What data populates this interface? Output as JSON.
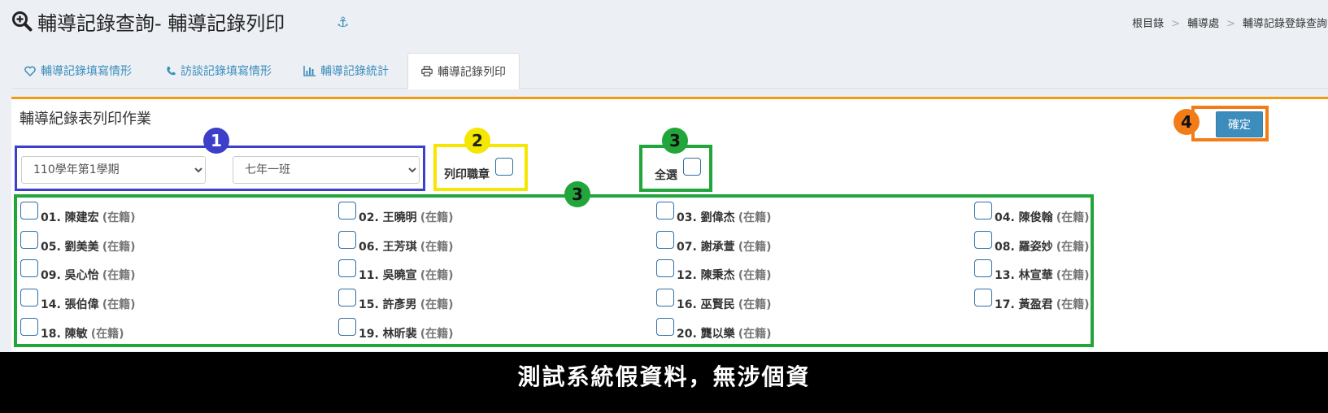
{
  "header": {
    "title": "輔導記錄查詢- 輔導記錄列印",
    "anchor_icon": "anchor-icon",
    "breadcrumb": [
      "根目錄",
      "輔導處",
      "輔導記錄登錄查詢"
    ]
  },
  "tabs": [
    {
      "label": "輔導記錄填寫情形",
      "icon": "heart-icon"
    },
    {
      "label": "訪談記錄填寫情形",
      "icon": "phone-icon"
    },
    {
      "label": "輔導記錄統計",
      "icon": "bar-chart-icon"
    },
    {
      "label": "輔導記錄列印",
      "icon": "print-icon",
      "active": true
    }
  ],
  "panel": {
    "title": "輔導紀錄表列印作業",
    "semester_select": {
      "value": "110學年第1學期"
    },
    "class_select": {
      "value": "七年一班"
    },
    "print_seal_label": "列印職章",
    "select_all_label": "全選",
    "confirm_label": "確定"
  },
  "students": [
    {
      "label": "01. 陳建宏",
      "status": "(在籍)"
    },
    {
      "label": "02. 王曉明",
      "status": "(在籍)"
    },
    {
      "label": "03. 劉偉杰",
      "status": "(在籍)"
    },
    {
      "label": "04. 陳俊翰",
      "status": "(在籍)"
    },
    {
      "label": "05. 劉美美",
      "status": "(在籍)"
    },
    {
      "label": "06. 王芳琪",
      "status": "(在籍)"
    },
    {
      "label": "07. 謝承萱",
      "status": "(在籍)"
    },
    {
      "label": "08. 羅姿妙",
      "status": "(在籍)"
    },
    {
      "label": "09. 吳心怡",
      "status": "(在籍)"
    },
    {
      "label": "11. 吳曉宣",
      "status": "(在籍)"
    },
    {
      "label": "12. 陳秉杰",
      "status": "(在籍)"
    },
    {
      "label": "13. 林宣華",
      "status": "(在籍)"
    },
    {
      "label": "14. 張伯偉",
      "status": "(在籍)"
    },
    {
      "label": "15. 許彥男",
      "status": "(在籍)"
    },
    {
      "label": "16. 巫賢民",
      "status": "(在籍)"
    },
    {
      "label": "17. 黃盈君",
      "status": "(在籍)"
    },
    {
      "label": "18. 陳敏",
      "status": "(在籍)"
    },
    {
      "label": "19. 林昕裴",
      "status": "(在籍)"
    },
    {
      "label": "20. 龔以樂",
      "status": "(在籍)"
    }
  ],
  "annotations": [
    {
      "num": "1",
      "color": "#3c3fc9"
    },
    {
      "num": "2",
      "color": "#f5e700"
    },
    {
      "num": "3",
      "color": "#22a53b"
    },
    {
      "num": "3",
      "color": "#22a53b"
    },
    {
      "num": "4",
      "color": "#f27c17"
    }
  ],
  "footer": {
    "text": "測試系統假資料，無涉個資"
  }
}
